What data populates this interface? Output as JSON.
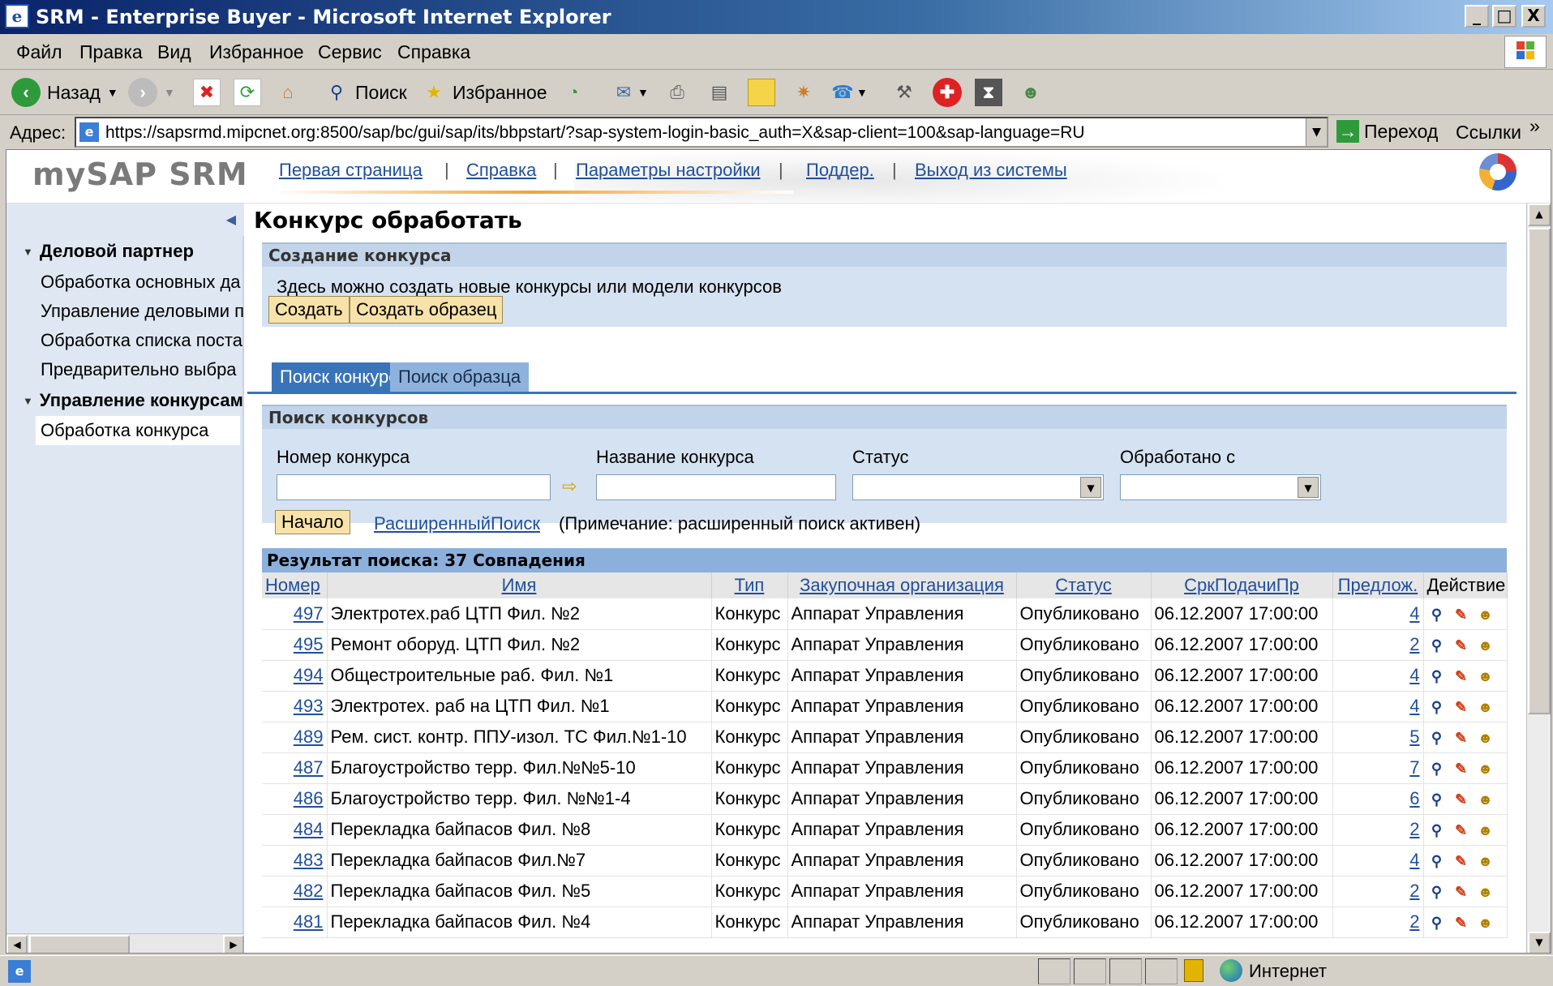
{
  "window": {
    "title": "SRM - Enterprise Buyer - Microsoft Internet Explorer",
    "minimize": "_",
    "maximize": "□",
    "close": "X"
  },
  "menu": [
    "Файл",
    "Правка",
    "Вид",
    "Избранное",
    "Сервис",
    "Справка"
  ],
  "toolbar": {
    "back": "Назад",
    "search": "Поиск",
    "favorites": "Избранное"
  },
  "address": {
    "label": "Адрес:",
    "url": "https://sapsrmd.mipcnet.org:8500/sap/bc/gui/sap/its/bbpstart/?sap-system-login-basic_auth=X&sap-client=100&sap-language=RU",
    "go": "Переход",
    "links": "Ссылки",
    "more": "»"
  },
  "sap_header": {
    "logo": "mySAP SRM",
    "nav": [
      "Первая страница",
      "Справка",
      "Параметры настройки",
      "Поддер.",
      "Выход из системы"
    ],
    "separator": "|"
  },
  "leftnav": {
    "groups": [
      {
        "label": "Деловой партнер",
        "items": [
          "Обработка основных да",
          "Управление деловыми п",
          "Обработка списка поста",
          "Предварительно выбра"
        ]
      },
      {
        "label": "Управление конкурсам",
        "items": [
          "Обработка конкурса"
        ]
      }
    ]
  },
  "page": {
    "title": "Конкурс обработать",
    "create_panel": {
      "header": "Создание конкурса",
      "text": "Здесь можно создать новые конкурсы или модели конкурсов",
      "create": "Создать",
      "create_template": "Создать образец"
    },
    "tabs": [
      "Поиск конкурса",
      "Поиск образца"
    ],
    "search_panel": {
      "header": "Поиск конкурсов",
      "fields": [
        "Номер конкурса",
        "Название конкурса",
        "Статус",
        "Обработано с"
      ],
      "start": "Начало",
      "advanced_link": "РасширенныйПоиск",
      "note": "(Примечание: расширенный поиск активен)"
    }
  },
  "results": {
    "header": "Результат поиска:  37 Совпадения",
    "columns": [
      "Номер",
      "Имя",
      "Тип",
      "Закупочная организация",
      "Статус",
      "СркПодачиПр",
      "Предлож.",
      "Действие"
    ],
    "rows": [
      {
        "num": "497",
        "name": "Электротех.раб ЦТП Фил. №2",
        "type": "Конкурс",
        "org": "Аппарат Управления",
        "status": "Опубликовано",
        "deadline": "06.12.2007 17:00:00",
        "bids": "4"
      },
      {
        "num": "495",
        "name": "Ремонт оборуд. ЦТП Фил. №2",
        "type": "Конкурс",
        "org": "Аппарат Управления",
        "status": "Опубликовано",
        "deadline": "06.12.2007 17:00:00",
        "bids": "2"
      },
      {
        "num": "494",
        "name": "Общестроительные раб. Фил. №1",
        "type": "Конкурс",
        "org": "Аппарат Управления",
        "status": "Опубликовано",
        "deadline": "06.12.2007 17:00:00",
        "bids": "4"
      },
      {
        "num": "493",
        "name": "Электротех. раб на ЦТП Фил. №1",
        "type": "Конкурс",
        "org": "Аппарат Управления",
        "status": "Опубликовано",
        "deadline": "06.12.2007 17:00:00",
        "bids": "4"
      },
      {
        "num": "489",
        "name": "Рем. сист. контр. ППУ-изол. ТС Фил.№1-10",
        "type": "Конкурс",
        "org": "Аппарат Управления",
        "status": "Опубликовано",
        "deadline": "06.12.2007 17:00:00",
        "bids": "5"
      },
      {
        "num": "487",
        "name": "Благоустройство терр. Фил.№№5-10",
        "type": "Конкурс",
        "org": "Аппарат Управления",
        "status": "Опубликовано",
        "deadline": "06.12.2007 17:00:00",
        "bids": "7"
      },
      {
        "num": "486",
        "name": "Благоустройство терр. Фил. №№1-4",
        "type": "Конкурс",
        "org": "Аппарат Управления",
        "status": "Опубликовано",
        "deadline": "06.12.2007 17:00:00",
        "bids": "6"
      },
      {
        "num": "484",
        "name": "Перекладка байпасов Фил. №8",
        "type": "Конкурс",
        "org": "Аппарат Управления",
        "status": "Опубликовано",
        "deadline": "06.12.2007 17:00:00",
        "bids": "2"
      },
      {
        "num": "483",
        "name": "Перекладка байпасов Фил.№7",
        "type": "Конкурс",
        "org": "Аппарат Управления",
        "status": "Опубликовано",
        "deadline": "06.12.2007 17:00:00",
        "bids": "4"
      },
      {
        "num": "482",
        "name": "Перекладка байпасов Фил. №5",
        "type": "Конкурс",
        "org": "Аппарат Управления",
        "status": "Опубликовано",
        "deadline": "06.12.2007 17:00:00",
        "bids": "2"
      },
      {
        "num": "481",
        "name": "Перекладка байпасов Фил. №4",
        "type": "Конкурс",
        "org": "Аппарат Управления",
        "status": "Опубликовано",
        "deadline": "06.12.2007 17:00:00",
        "bids": "2"
      }
    ]
  },
  "statusbar": {
    "zone": "Интернет"
  }
}
